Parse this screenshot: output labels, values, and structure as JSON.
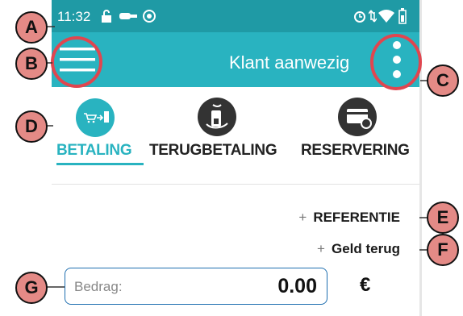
{
  "status_bar": {
    "time": "11:32",
    "left_icons": [
      "lock-open-icon",
      "key-icon",
      "sync-icon"
    ],
    "right_icons": [
      "alarm-icon",
      "data-arrows-icon",
      "wifi-icon",
      "battery-icon"
    ]
  },
  "app_bar": {
    "title": "Klant aanwezig",
    "menu_icon": "hamburger-menu-icon",
    "overflow_icon": "more-vert-icon"
  },
  "tabs": [
    {
      "label": "BETALING",
      "icon": "payment-icon",
      "active": true
    },
    {
      "label": "TERUGBETALING",
      "icon": "refund-icon",
      "active": false
    },
    {
      "label": "RESERVERING",
      "icon": "card-reservation-icon",
      "active": false
    }
  ],
  "actions": {
    "reference": {
      "prefix": "+",
      "label": "REFERENTIE"
    },
    "cashback": {
      "prefix": "+",
      "label": "Geld terug"
    }
  },
  "amount": {
    "label": "Bedrag:",
    "value": "0.00",
    "currency": "€"
  },
  "markers": [
    "A",
    "B",
    "C",
    "D",
    "E",
    "F",
    "G"
  ],
  "colors": {
    "status_bar": "#1f9aa5",
    "app_bar": "#29b3c0",
    "accent": "#29b3c0",
    "highlight_circle": "#e0464f",
    "marker": "#e48a86",
    "input_border": "#1f6fb0"
  }
}
